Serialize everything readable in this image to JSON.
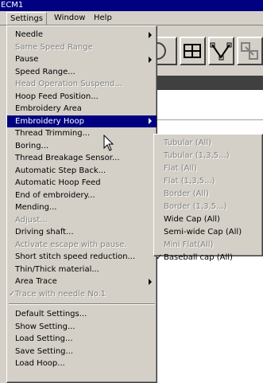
{
  "window": {
    "title": "ECM1"
  },
  "menubar": {
    "settings": "Settings",
    "window": "Window",
    "help": "Help"
  },
  "main_menu": {
    "group1": [
      {
        "label": "Needle",
        "submenu": true
      },
      {
        "label": "Same Speed Range",
        "disabled": true
      },
      {
        "label": "Pause",
        "submenu": true
      },
      {
        "label": "Speed Range..."
      },
      {
        "label": "Head Operation Suspend...",
        "disabled": true
      },
      {
        "label": "Hoop Feed Position..."
      },
      {
        "label": "Embroidery Area"
      },
      {
        "label": "Embroidery Hoop",
        "submenu": true,
        "selected": true
      },
      {
        "label": "Thread Trimming..."
      },
      {
        "label": "Boring..."
      },
      {
        "label": "Thread Breakage Sensor..."
      },
      {
        "label": "Automatic Step Back..."
      },
      {
        "label": "Automatic Hoop Feed"
      },
      {
        "label": "End of embroidery..."
      },
      {
        "label": "Mending..."
      },
      {
        "label": "Adjust...",
        "disabled": true
      },
      {
        "label": "Driving shaft..."
      },
      {
        "label": "Activate escape with pause.",
        "disabled": true
      },
      {
        "label": "Short stitch speed reduction..."
      },
      {
        "label": "Thin/Thick material..."
      },
      {
        "label": "Area Trace",
        "submenu": true
      },
      {
        "label": "Trace with needle No.1",
        "disabled": true,
        "checked": true
      }
    ],
    "group2": [
      {
        "label": "Default Settings..."
      },
      {
        "label": "Show Setting..."
      },
      {
        "label": "Load Setting..."
      },
      {
        "label": "Save Setting..."
      },
      {
        "label": "Load Hoop..."
      }
    ]
  },
  "sub_menu": [
    {
      "label": "Tubular (All)",
      "disabled": true
    },
    {
      "label": "Tubular (1,3,5...)",
      "disabled": true
    },
    {
      "label": "Flat (All)",
      "disabled": true
    },
    {
      "label": "Flat (1,3,5...)",
      "disabled": true
    },
    {
      "label": "Border (All)",
      "disabled": true
    },
    {
      "label": "Border (1,3,5...)",
      "disabled": true
    },
    {
      "label": "Wide Cap (All)"
    },
    {
      "label": "Semi-wide Cap (All)"
    },
    {
      "label": "Mini Flat(All)",
      "disabled": true
    },
    {
      "label": "Baseball cap (All)",
      "checked": true
    }
  ],
  "check_mark": "✓",
  "colors": {
    "titlebar": "#000080",
    "face": "#d4d0c8",
    "highlight": "#000080"
  }
}
